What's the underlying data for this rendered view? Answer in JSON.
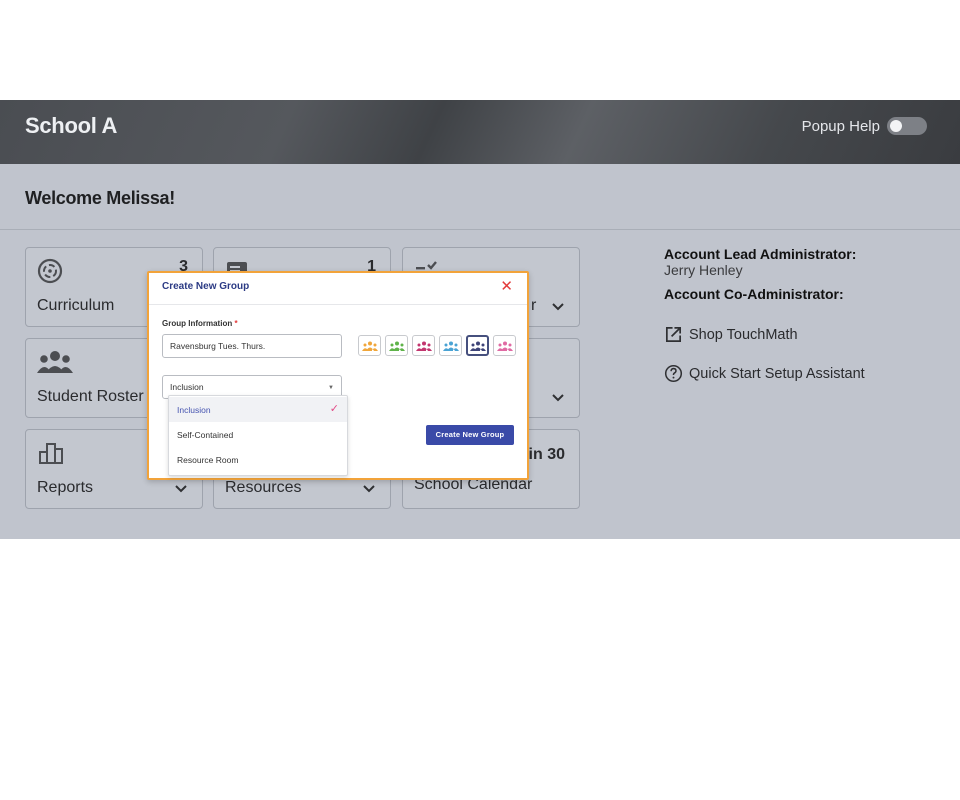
{
  "header": {
    "school_name": "School A",
    "popup_help_label": "Popup Help",
    "popup_help_on": false
  },
  "welcome": "Welcome Melissa!",
  "cards": [
    {
      "label": "Curriculum",
      "count": "3",
      "icon": "curriculum-icon"
    },
    {
      "label": "",
      "count": "1",
      "icon": "assignments-icon"
    },
    {
      "label": "r",
      "count": "",
      "icon": "checklist-icon"
    },
    {
      "label": "Student Roster",
      "count": "",
      "icon": "students-icon"
    },
    {
      "label": "",
      "count": "",
      "icon": ""
    },
    {
      "label": "",
      "count": "",
      "icon": ""
    },
    {
      "label": "Reports",
      "count": "",
      "icon": "bar-chart-icon"
    },
    {
      "label": "Resources",
      "count": "",
      "icon": ""
    },
    {
      "label": "School Calendar",
      "count": "in 30",
      "icon": ""
    }
  ],
  "right_panel": {
    "lead_admin_title": "Account Lead Administrator:",
    "lead_admin_name": "Jerry Henley",
    "co_admin_title": "Account Co-Administrator:",
    "shop_link": "Shop TouchMath",
    "setup_link": "Quick Start Setup Assistant"
  },
  "modal": {
    "title": "Create New Group",
    "close_icon": "close-icon",
    "group_info_label": "Group Information",
    "required_mark": "*",
    "group_name_value": "Ravensburg Tues. Thurs.",
    "group_type_value": "Inclusion",
    "create_button": "Create New Group",
    "swatch_colors": [
      "#f0a63a",
      "#5fb34a",
      "#c2356e",
      "#4aa3d4",
      "#3e4478",
      "#e06aa3"
    ],
    "selected_swatch": 4
  },
  "dropdown": {
    "options": [
      "Inclusion",
      "Self-Contained",
      "Resource Room"
    ],
    "selected": "Inclusion"
  }
}
